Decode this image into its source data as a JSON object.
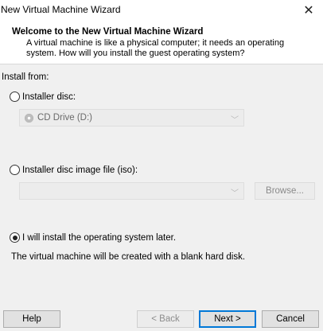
{
  "window": {
    "title": "New Virtual Machine Wizard",
    "close_glyph": "✕"
  },
  "header": {
    "title": "Welcome to the New Virtual Machine Wizard",
    "subtitle": "A virtual machine is like a physical computer; it needs an operating system. How will you install the guest operating system?"
  },
  "main": {
    "install_from_label": "Install from:",
    "options": [
      {
        "label": "Installer disc:",
        "selected": false
      },
      {
        "label": "Installer disc image file (iso):",
        "selected": false
      },
      {
        "label": "I will install the operating system later.",
        "selected": true
      }
    ],
    "disc_drive": {
      "value": "CD Drive (D:)",
      "icon": "cd-disc-icon"
    },
    "iso_path": {
      "value": ""
    },
    "browse_label": "Browse...",
    "later_description": "The virtual machine will be created with a blank hard disk."
  },
  "footer": {
    "help_label": "Help",
    "back_label": "< Back",
    "next_label": "Next >",
    "cancel_label": "Cancel"
  },
  "colors": {
    "accent": "#0078d7",
    "panel_bg": "#f0f0f0",
    "header_bg": "#ffffff"
  }
}
